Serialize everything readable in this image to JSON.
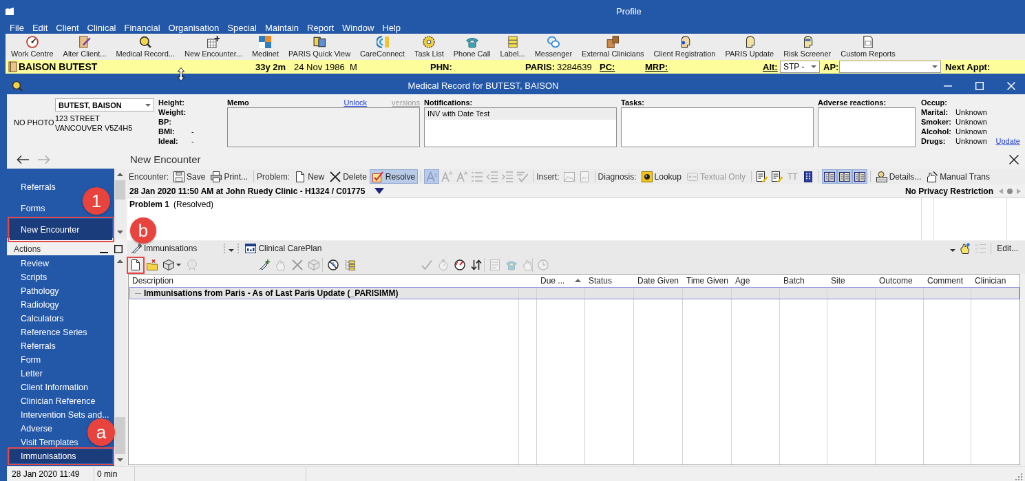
{
  "window": {
    "title": "Profile"
  },
  "menu": [
    "File",
    "Edit",
    "Client",
    "Clinical",
    "Financial",
    "Organisation",
    "Special",
    "Maintain",
    "Report",
    "Window",
    "Help"
  ],
  "toolbar": [
    "Work Centre",
    "Alter Client...",
    "Medical Record...",
    "New Encounter...",
    "Medinet",
    "PARIS Quick View",
    "CareConnect",
    "Task List",
    "Phone Call",
    "Label...",
    "Messenger",
    "External Clinicians",
    "Client Registration",
    "PARIS Update",
    "Risk Screener",
    "Custom Reports"
  ],
  "patient_bar": {
    "name": "BAISON BUTEST",
    "age": "33y 2m",
    "dob": "24 Nov 1986",
    "sex": "M",
    "phn_label": "PHN:",
    "paris_label": "PARIS:",
    "paris_value": "3284639",
    "pc_label": "PC:",
    "mrp_label": "MRP:",
    "alt_label": "Alt:",
    "alt_value": "STP -",
    "ap_label": "AP:",
    "next_appt_label": "Next Appt:"
  },
  "record_window": {
    "title": "Medical Record for BUTEST, BAISON"
  },
  "client": {
    "photo": "NO PHOTO",
    "name": "BUTEST, BAISON",
    "address": [
      "123 STREET",
      "VANCOUVER V5Z4H5"
    ],
    "vital_labels": [
      "Height:",
      "Weight:",
      "BP:"
    ],
    "body_indices": [
      {
        "label": "BMI:",
        "value": "-"
      },
      {
        "label": "Ideal:",
        "value": "-"
      }
    ]
  },
  "memo": {
    "label": "Memo",
    "unlock_link": "Unlock",
    "versions_link": "versions",
    "versions_disabled": true
  },
  "notifications": {
    "label": "Notifications:",
    "items": [
      {
        "text": "INV with Date Test",
        "selected": true
      }
    ]
  },
  "tasks": {
    "label": "Tasks:"
  },
  "adverse_reactions": {
    "label": "Adverse reactions:"
  },
  "social_history": {
    "items": [
      {
        "label": "Occup:"
      },
      {
        "label": "Marital:",
        "value": "Unknown"
      },
      {
        "label": "Smoker:",
        "value": "Unknown"
      },
      {
        "label": "Alcohol:",
        "value": "Unknown"
      },
      {
        "label": "Drugs:",
        "value": "Unknown"
      }
    ],
    "update_link": "Update"
  },
  "navigation": {
    "back_disabled": false,
    "forward_disabled": true,
    "page_title": "New Encounter"
  },
  "sidebar": {
    "items": [
      {
        "label": "Referrals",
        "selected": false,
        "highlighted": false
      },
      {
        "label": "Forms",
        "selected": false,
        "highlighted": false
      },
      {
        "label": "New Encounter",
        "selected": true,
        "highlighted": true
      }
    ],
    "actions_title": "Actions",
    "actions": [
      {
        "label": "Review",
        "selected": false,
        "highlighted": false
      },
      {
        "label": "Scripts",
        "selected": false,
        "highlighted": false
      },
      {
        "label": "Pathology",
        "selected": false,
        "highlighted": false
      },
      {
        "label": "Radiology",
        "selected": false,
        "highlighted": false
      },
      {
        "label": "Calculators",
        "selected": false,
        "highlighted": false
      },
      {
        "label": "Reference Series",
        "selected": false,
        "highlighted": false
      },
      {
        "label": "Referrals",
        "selected": false,
        "highlighted": false
      },
      {
        "label": "Form",
        "selected": false,
        "highlighted": false
      },
      {
        "label": "Letter",
        "selected": false,
        "highlighted": false
      },
      {
        "label": "Client Information",
        "selected": false,
        "highlighted": false
      },
      {
        "label": "Clinician Reference",
        "selected": false,
        "highlighted": false
      },
      {
        "label": "Intervention Sets and...",
        "selected": false,
        "highlighted": false
      },
      {
        "label": "Adverse",
        "selected": false,
        "highlighted": false
      },
      {
        "label": "Visit Templates",
        "selected": false,
        "highlighted": false
      },
      {
        "label": "Immunisations",
        "selected": true,
        "highlighted": true
      }
    ]
  },
  "encounter_toolbar": [
    [
      {
        "kind": "label",
        "text": "Encounter:"
      },
      {
        "kind": "button",
        "label": "Save",
        "disabled": false,
        "selected": false
      },
      {
        "kind": "button",
        "label": "Print...",
        "disabled": false,
        "selected": false
      }
    ],
    [
      {
        "kind": "label",
        "text": "Problem:"
      },
      {
        "kind": "button",
        "label": "New",
        "disabled": false,
        "selected": false
      },
      {
        "kind": "button",
        "label": "Delete",
        "disabled": false,
        "selected": false
      },
      {
        "kind": "button",
        "label": "Resolve",
        "disabled": false,
        "selected": true
      }
    ],
    [
      {
        "kind": "icon",
        "disabled": true,
        "selected": true
      },
      {
        "kind": "icon",
        "disabled": true,
        "selected": false
      },
      {
        "kind": "icon",
        "disabled": true,
        "selected": false
      },
      {
        "kind": "icon",
        "disabled": true,
        "selected": false
      },
      {
        "kind": "icon",
        "disabled": true,
        "selected": false
      },
      {
        "kind": "icon",
        "disabled": true,
        "selected": false
      },
      {
        "kind": "icon",
        "disabled": true,
        "selected": false
      }
    ],
    [
      {
        "kind": "label",
        "text": "Insert:"
      },
      {
        "kind": "icon",
        "disabled": true,
        "selected": false
      },
      {
        "kind": "icon",
        "disabled": true,
        "selected": false
      }
    ],
    [
      {
        "kind": "label",
        "text": "Diagnosis:"
      },
      {
        "kind": "button",
        "label": "Lookup",
        "disabled": false,
        "selected": false
      },
      {
        "kind": "button",
        "label": "Textual Only",
        "disabled": true,
        "selected": false
      }
    ],
    [
      {
        "kind": "icon",
        "disabled": false,
        "selected": false
      },
      {
        "kind": "icon",
        "disabled": false,
        "selected": false
      },
      {
        "kind": "button",
        "label": "TT",
        "disabled": true,
        "selected": false
      },
      {
        "kind": "icon",
        "disabled": false,
        "selected": false
      }
    ],
    [
      {
        "kind": "icon",
        "disabled": false,
        "selected": true
      },
      {
        "kind": "icon",
        "disabled": false,
        "selected": true
      },
      {
        "kind": "icon",
        "disabled": false,
        "selected": true
      }
    ],
    [
      {
        "kind": "button",
        "label": "Details...",
        "disabled": false,
        "selected": false
      },
      {
        "kind": "button",
        "label": "Manual Trans",
        "disabled": false,
        "selected": false
      }
    ]
  ],
  "encounter": {
    "heading": "28 Jan 2020 11:50 AM at John Ruedy Clinic - H1324 / C01775",
    "privacy": "No Privacy Restriction",
    "problems": [
      {
        "name": "Problem 1",
        "status": "(Resolved)"
      }
    ]
  },
  "immunisations": {
    "buttons": [
      {
        "label": "Immunisations"
      },
      {
        "label": "Clinical CarePlan"
      }
    ],
    "side_tools": [
      {
        "disabled": false
      },
      {
        "disabled": true
      }
    ],
    "edit_button": "Edit...",
    "tools": [
      [
        {
          "disabled": false,
          "highlighted": true
        },
        {
          "disabled": false,
          "highlighted": false
        },
        {
          "disabled": false,
          "highlighted": false
        }
      ],
      [
        {
          "disabled": true,
          "highlighted": false
        }
      ],
      [
        {
          "disabled": false,
          "highlighted": false
        },
        {
          "disabled": true,
          "highlighted": false
        },
        {
          "disabled": true,
          "highlighted": false
        },
        {
          "disabled": true,
          "highlighted": false
        }
      ],
      [
        {
          "disabled": false,
          "highlighted": false
        },
        {
          "disabled": false,
          "highlighted": false
        }
      ],
      [
        {
          "disabled": true,
          "highlighted": false
        },
        {
          "disabled": true,
          "highlighted": false
        },
        {
          "disabled": false,
          "highlighted": false
        },
        {
          "disabled": false,
          "highlighted": false
        }
      ],
      [
        {
          "disabled": true,
          "highlighted": false
        },
        {
          "disabled": true,
          "highlighted": false
        },
        {
          "disabled": true,
          "highlighted": false
        }
      ],
      [
        {
          "disabled": true,
          "highlighted": false
        }
      ]
    ],
    "table": {
      "columns": [
        {
          "label": "Description",
          "sorted": false
        },
        {
          "label": "Due ...",
          "sorted": true
        },
        {
          "label": "Status",
          "sorted": false
        },
        {
          "label": "Date Given",
          "sorted": false
        },
        {
          "label": "Time Given",
          "sorted": false
        },
        {
          "label": "Age",
          "sorted": false
        },
        {
          "label": "Batch",
          "sorted": false
        },
        {
          "label": "Site",
          "sorted": false
        },
        {
          "label": "Outcome",
          "sorted": false
        },
        {
          "label": "Comment",
          "sorted": false
        },
        {
          "label": "Clinician",
          "sorted": false
        }
      ],
      "rows": [
        {
          "kind": "group",
          "description": "Immunisations from Paris - As of Last Paris Update (_PARISIMM)",
          "selected": true
        }
      ]
    }
  },
  "status_bar": [
    "28 Jan 2020 11:49",
    "0 min"
  ],
  "annotations": [
    {
      "label": "1"
    },
    {
      "label": "a"
    },
    {
      "label": "b"
    }
  ]
}
